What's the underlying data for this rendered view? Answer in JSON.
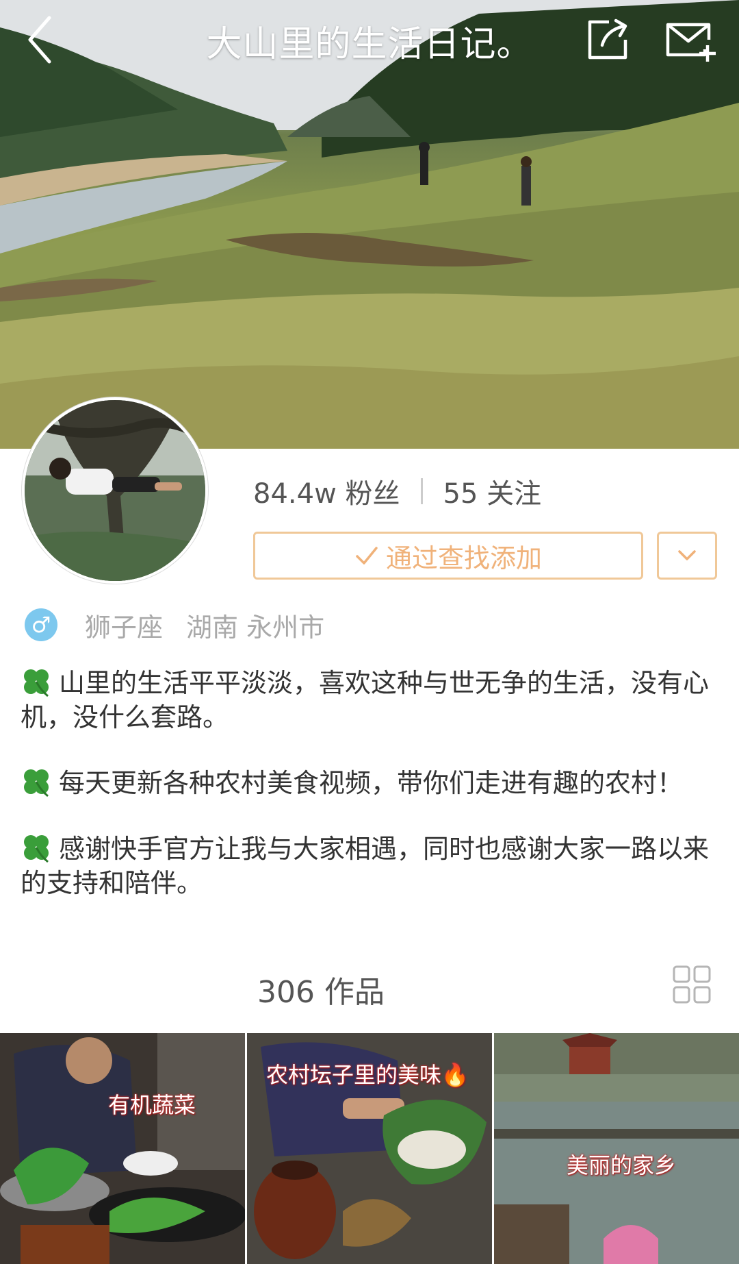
{
  "header": {
    "title": "大山里的生活日记。",
    "back_icon": "chevron-left-icon",
    "share_icon": "share-icon",
    "message_icon": "mail-plus-icon"
  },
  "profile": {
    "followers": "84.4w 粉丝",
    "following": "55 关注",
    "follow_button_label": "通过查找添加",
    "more_icon": "chevron-down-icon",
    "gender_symbol": "♂",
    "zodiac": "狮子座",
    "location": "湖南 永州市"
  },
  "bio": [
    "山里的生活平平淡淡，喜欢这种与世无争的生活，没有心机，没什么套路。",
    "每天更新各种农村美食视频，带你们走进有趣的农村！",
    "感谢快手官方让我与大家相遇，同时也感谢大家一路以来的支持和陪伴。"
  ],
  "works": {
    "count_label": "306 作品",
    "grid_icon": "grid-view-icon"
  },
  "thumbnails": [
    {
      "caption": "有机蔬菜"
    },
    {
      "caption": "农村坛子里的美味🔥"
    },
    {
      "caption": "美丽的家乡"
    }
  ],
  "colors": {
    "accent": "#f0b27a",
    "accent_border": "#f0c898",
    "gender_badge": "#7dc8ee",
    "clover": "#3a9e3a"
  }
}
